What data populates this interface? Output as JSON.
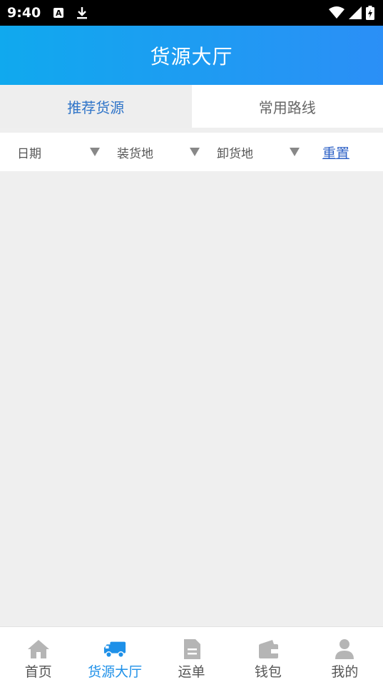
{
  "status_bar": {
    "time": "9:40",
    "notification_badge": "A",
    "icons": [
      "a-badge-icon",
      "download-icon",
      "wifi-icon",
      "signal-icon",
      "battery-icon"
    ]
  },
  "header": {
    "title": "货源大厅"
  },
  "tabs": [
    {
      "label": "推荐货源",
      "active": true
    },
    {
      "label": "常用路线",
      "active": false
    }
  ],
  "filters": {
    "date": "日期",
    "load_place": "装货地",
    "unload_place": "卸货地",
    "reset": "重置"
  },
  "bottom_nav": [
    {
      "label": "首页",
      "icon": "home-icon",
      "active": false
    },
    {
      "label": "货源大厅",
      "icon": "truck-icon",
      "active": true
    },
    {
      "label": "运单",
      "icon": "document-icon",
      "active": false
    },
    {
      "label": "钱包",
      "icon": "wallet-icon",
      "active": false
    },
    {
      "label": "我的",
      "icon": "user-icon",
      "active": false
    }
  ],
  "colors": {
    "accent": "#1e90e8",
    "header_start": "#10a9ee",
    "header_end": "#2b8ff6",
    "tab_active_text": "#2f74c8",
    "reset_link": "#2f62c6"
  }
}
